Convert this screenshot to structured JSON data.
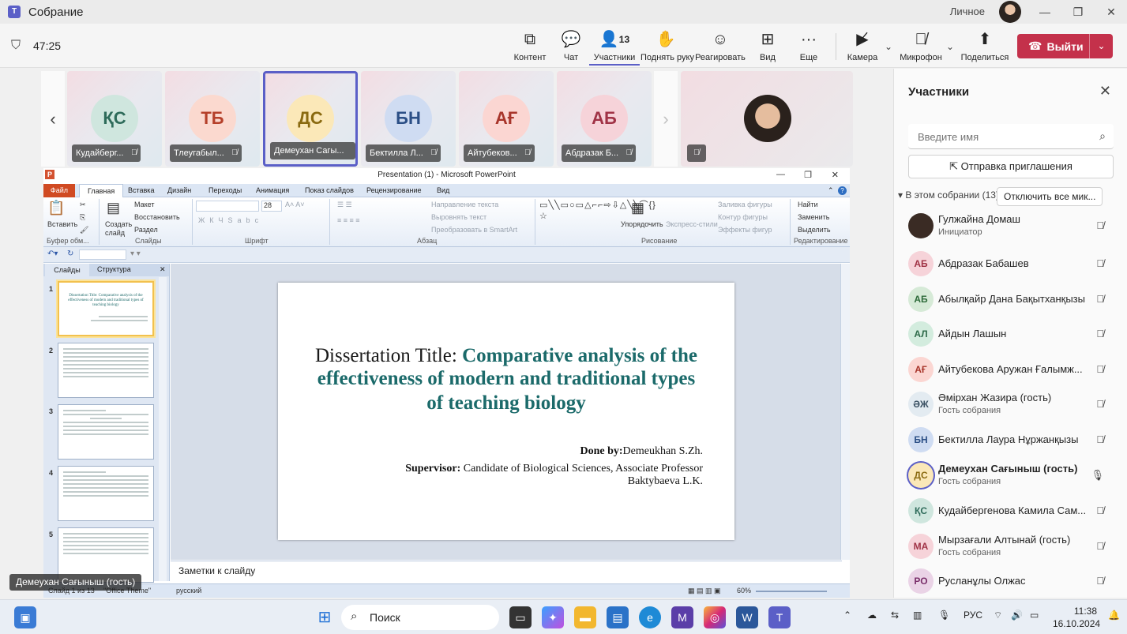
{
  "window": {
    "title": "Собрание",
    "profile": "Личное",
    "minimize": "—",
    "restore": "❐",
    "close": "✕"
  },
  "meeting": {
    "timer": "47:25",
    "toolbar": [
      {
        "id": "content",
        "label": "Контент",
        "icon": "share-tray-icon"
      },
      {
        "id": "chat",
        "label": "Чат",
        "icon": "chat-icon"
      },
      {
        "id": "people",
        "label": "Участники",
        "icon": "people-icon",
        "count": "13"
      },
      {
        "id": "raise",
        "label": "Поднять руку",
        "icon": "hand-icon"
      },
      {
        "id": "react",
        "label": "Реагировать",
        "icon": "emoji-icon"
      },
      {
        "id": "view",
        "label": "Вид",
        "icon": "grid-icon"
      },
      {
        "id": "more",
        "label": "Еще",
        "icon": "more-icon"
      },
      {
        "id": "camera",
        "label": "Камера",
        "icon": "camera-off-icon"
      },
      {
        "id": "mic",
        "label": "Микрофон",
        "icon": "mic-off-icon"
      },
      {
        "id": "share",
        "label": "Поделиться",
        "icon": "share-icon"
      }
    ],
    "leave_label": "Выйти"
  },
  "strip": {
    "tiles": [
      {
        "initials": "ҚС",
        "name": "Кудайберг...",
        "bg": "#cfe6de",
        "fg": "#2e6b5a"
      },
      {
        "initials": "ТБ",
        "name": "Тлеугабыл...",
        "bg": "#fbd9cf",
        "fg": "#b5402a"
      },
      {
        "initials": "ДС",
        "name": "Демеухан Сагы...",
        "bg": "#fbe8b8",
        "fg": "#8a6a10"
      },
      {
        "initials": "БН",
        "name": "Бектилла Л...",
        "bg": "#cfdcf2",
        "fg": "#2b4f86"
      },
      {
        "initials": "АҒ",
        "name": "Айтубеков...",
        "bg": "#fbd6d2",
        "fg": "#a8352b"
      },
      {
        "initials": "АБ",
        "name": "Абдразак Б...",
        "bg": "#f6d3d9",
        "fg": "#a03346"
      }
    ]
  },
  "ppt": {
    "title": "Presentation (1) - Microsoft PowerPoint",
    "tabs": [
      "Файл",
      "Главная",
      "Вставка",
      "Дизайн",
      "Переходы",
      "Анимация",
      "Показ слайдов",
      "Рецензирование",
      "Вид"
    ],
    "ribbon": {
      "paste": "Вставить",
      "create_slide": "Создать слайд",
      "layout": "Макет",
      "restore": "Восстановить",
      "section": "Раздел",
      "font_size": "28",
      "text_dir": "Направление текста",
      "align_text": "Выровнять текст",
      "smartart": "Преобразовать в SmartArt",
      "arrange": "Упорядочить",
      "express": "Экспресс-стили",
      "fill": "Заливка фигуры",
      "outline": "Контур фигуры",
      "effects": "Эффекты фигур",
      "find": "Найти",
      "replace": "Заменить",
      "select": "Выделить",
      "groups": [
        "Буфер обм...",
        "Слайды",
        "Шрифт",
        "Абзац",
        "Рисование",
        "Редактирование"
      ]
    },
    "panel_tabs": [
      "Слайды",
      "Структура"
    ],
    "thumbs": [
      "1",
      "2",
      "3",
      "4",
      "5"
    ],
    "thumb1_text": "Dissertation Title: Comparative analysis of the effectiveness of modern and traditional types of teaching biology",
    "slide": {
      "title_plain": "Dissertation Title: ",
      "title_bold": "Comparative analysis of the effectiveness of modern and traditional types",
      "title_line3": "of teaching biology",
      "done_label": "Done by:",
      "done_name": "Demeukhan S.Zh.",
      "supervisor_label": "Supervisor:",
      "supervisor_text": "Candidate of Biological Sciences, Associate Professor",
      "supervisor_name": "Baktybaeva L.K."
    },
    "notes_placeholder": "Заметки к слайду",
    "status": {
      "slide": "Слайд 1 из 13",
      "theme": "\"Office Theme\"",
      "lang": "русский",
      "zoom": "60%"
    }
  },
  "presenter_label": "Демеухан Сағыныш (гость)",
  "people": {
    "title": "Участники",
    "search_placeholder": "Введите имя",
    "invite_label": "Отправка приглашения",
    "section_label": "В этом собрании (13)",
    "mute_all_label": "Отключить все мик...",
    "list": [
      {
        "initials": "",
        "name": "Гулжайна Домаш",
        "role": "Инициатор",
        "bg": "#3a2b24",
        "fg": "#ffffff",
        "mic": "muted"
      },
      {
        "initials": "АБ",
        "name": "Абдразак Бабашев",
        "role": "",
        "bg": "#f6d3d9",
        "fg": "#a03346",
        "mic": "muted"
      },
      {
        "initials": "АБ",
        "name": "Абылқайр Дана Бақытханқызы",
        "role": "",
        "bg": "#d6ead7",
        "fg": "#2e6b3a",
        "mic": "muted"
      },
      {
        "initials": "АЛ",
        "name": "Айдын Лашын",
        "role": "",
        "bg": "#d3ecde",
        "fg": "#2e6b4a",
        "mic": "muted"
      },
      {
        "initials": "АҒ",
        "name": "Айтубекова Аружан Ғалымж...",
        "role": "",
        "bg": "#fbd6d2",
        "fg": "#a8352b",
        "mic": "muted"
      },
      {
        "initials": "ӘЖ",
        "name": "Әмірхан Жазира (гость)",
        "role": "Гость собрания",
        "bg": "#e3ebf1",
        "fg": "#3b5163",
        "mic": "muted"
      },
      {
        "initials": "БН",
        "name": "Бектилла Лаура Нұржанқызы",
        "role": "",
        "bg": "#cfdcf2",
        "fg": "#2b4f86",
        "mic": "muted"
      },
      {
        "initials": "ДС",
        "name": "Демеухан Сағыныш (гость)",
        "role": "Гость собрания",
        "bg": "#fbe8b8",
        "fg": "#8a6a10",
        "mic": "on"
      },
      {
        "initials": "ҚС",
        "name": "Кудайбергенова Камила Сам...",
        "role": "",
        "bg": "#cfe6de",
        "fg": "#2e6b5a",
        "mic": "muted"
      },
      {
        "initials": "МА",
        "name": "Мырзағали Алтынай (гость)",
        "role": "Гость собрания",
        "bg": "#f6d3d9",
        "fg": "#a03346",
        "mic": "muted"
      },
      {
        "initials": "РО",
        "name": "Русланұлы Олжас",
        "role": "",
        "bg": "#ead3e6",
        "fg": "#7a2f6a",
        "mic": "muted"
      }
    ]
  },
  "taskbar": {
    "search_label": "Поиск",
    "lang": "РУС",
    "time": "11:38",
    "date": "16.10.2024"
  }
}
